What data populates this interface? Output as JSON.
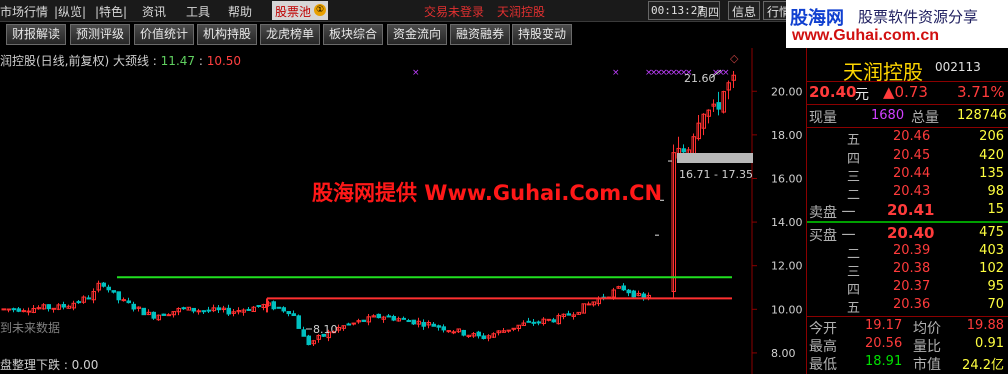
{
  "menu": {
    "items": [
      "市场行情",
      "|纵览|",
      "|特色|",
      "资讯",
      "工具",
      "帮助"
    ],
    "stock_pool": "股票池",
    "stock_pool_badge": "①",
    "login_status": "交易未登录",
    "current_stock": "天润控股",
    "time": "00:13:27",
    "weekday": "周四",
    "info_btn": "信息",
    "quote_btn": "行情"
  },
  "logo": {
    "main": "股海网",
    "sub": "股票软件资源分享",
    "url": "www.Guhai.com.cn"
  },
  "toolbar": {
    "buttons": [
      "财报解读",
      "预测评级",
      "价值统计",
      "机构持股",
      "龙虎榜单",
      "板块综合",
      "资金流向",
      "融资融券",
      "持股变动"
    ]
  },
  "chart": {
    "title_prefix": "润控股(日线,前复权) 大颈线 : ",
    "neckline_value": "11.47",
    "sep": " : ",
    "second_value": "10.50",
    "annotations": {
      "high": "21.60",
      "range": "16.71 - 17.35",
      "low": "8.10"
    },
    "future_data_label": "到未来数据",
    "indicator_label": "盘整理下跌 : 0.00",
    "watermark": "股海网提供 Www.Guhai.Com.CN",
    "colors": {
      "up": "#ff3030",
      "down": "#00c0c0",
      "neckline": "#20e020",
      "support": "#ff3030",
      "axis": "#8b0000"
    }
  },
  "chart_data": {
    "type": "candlestick",
    "title": "润控股(日线,前复权) 大颈线",
    "y_axis_ticks": [
      "20.00",
      "18.00",
      "16.00",
      "14.00",
      "12.00",
      "10.00",
      "8.00"
    ],
    "ylim": [
      7.4,
      21.8
    ],
    "neckline": 11.47,
    "support_line": 10.5,
    "low_marker": 8.1,
    "high_marker": 21.6
  },
  "quote": {
    "name": "天润控股",
    "code": "002113",
    "price": "20.40",
    "unit": "元",
    "change": "▲0.73",
    "change_pct": "3.71%",
    "current_volume_label": "现量",
    "current_volume": "1680",
    "total_volume_label": "总量",
    "total_volume": "128746",
    "sell": [
      {
        "label": "五",
        "price": "20.46",
        "vol": "206"
      },
      {
        "label": "四",
        "price": "20.45",
        "vol": "420"
      },
      {
        "label": "三",
        "price": "20.44",
        "vol": "135"
      },
      {
        "label": "二",
        "price": "20.43",
        "vol": "98"
      }
    ],
    "sell1": {
      "label": "卖盘 一",
      "price": "20.41",
      "vol": "15"
    },
    "buy1": {
      "label": "买盘 一",
      "price": "20.40",
      "vol": "475"
    },
    "buy": [
      {
        "label": "二",
        "price": "20.39",
        "vol": "403"
      },
      {
        "label": "三",
        "price": "20.38",
        "vol": "102"
      },
      {
        "label": "四",
        "price": "20.37",
        "vol": "95"
      },
      {
        "label": "五",
        "price": "20.36",
        "vol": "70"
      }
    ],
    "stats": {
      "open_label": "今开",
      "open": "19.17",
      "avg_label": "均价",
      "avg": "19.88",
      "high_label": "最高",
      "high": "20.56",
      "ratio_label": "量比",
      "ratio": "0.91",
      "low_label": "最低",
      "low": "18.91",
      "pe_label": "市值",
      "pe": "24.2亿"
    }
  }
}
